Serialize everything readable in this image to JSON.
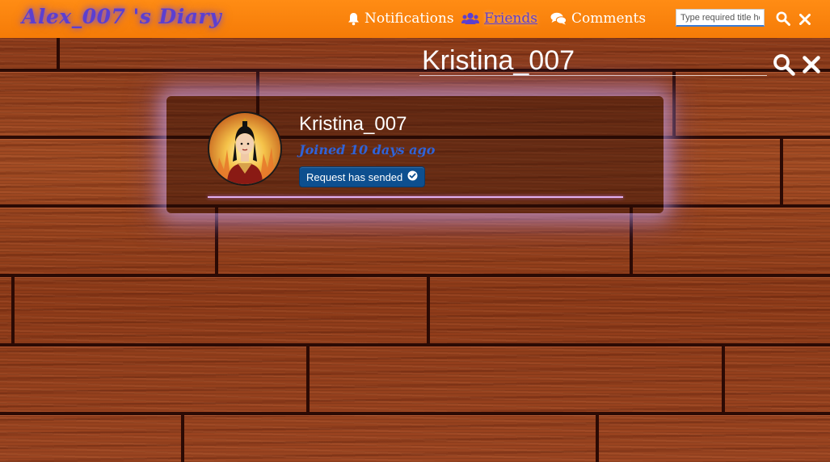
{
  "header": {
    "brand": "Alex_007 's Diary",
    "nav": [
      {
        "label": "Notifications",
        "icon": "bell-icon"
      },
      {
        "label": "Friends",
        "icon": "users-icon",
        "active": true
      },
      {
        "label": "Comments",
        "icon": "comments-icon"
      }
    ],
    "search_placeholder": "Type required title here"
  },
  "search": {
    "query": "Kristina_007"
  },
  "result": {
    "username": "Kristina_007",
    "joined": "Joined 10 days ago",
    "request_label": "Request has sended"
  },
  "colors": {
    "header_bg": "#f57b07",
    "brand": "#5b3fd0",
    "active_nav": "#5b3fd0",
    "joined_text": "#2f63d8",
    "request_button": "#0d4f8f",
    "divider": "#e0b0f0"
  }
}
